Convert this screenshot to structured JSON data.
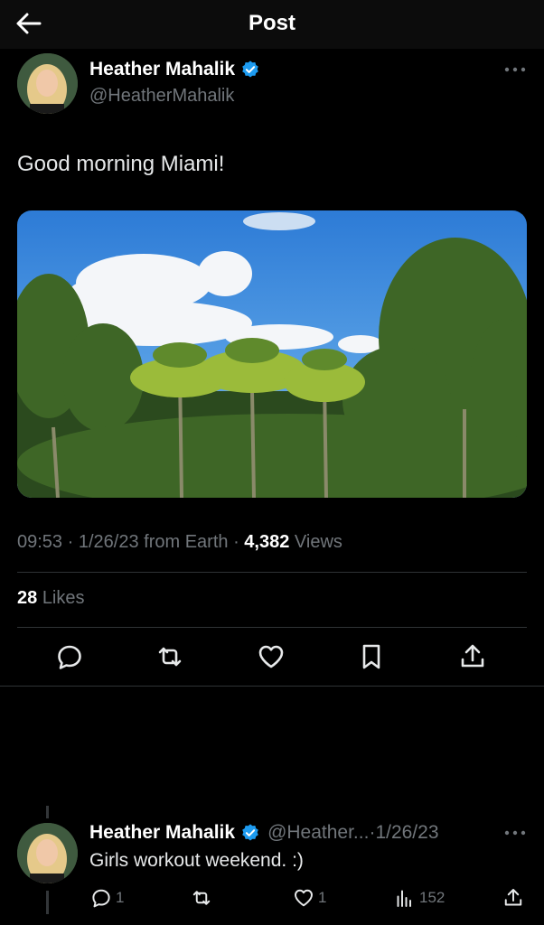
{
  "header": {
    "title": "Post"
  },
  "tweet": {
    "name": "Heather Mahalik",
    "handle": "@HeatherMahalik",
    "text": "Good morning Miami!",
    "time": "09:53",
    "date": "1/26/23",
    "source": "from Earth",
    "views_count": "4,382",
    "views_label": "Views",
    "likes_count": "28",
    "likes_label": "Likes"
  },
  "reply": {
    "name": "Heather Mahalik",
    "handle": "@Heather...",
    "date": "1/26/23",
    "text": "Girls workout weekend. :)",
    "reply_count": "1",
    "like_count": "1",
    "views_count": "152"
  },
  "icons": {
    "back": "arrow-left-icon",
    "verified": "verified-badge-icon",
    "more": "more-dots-icon",
    "reply": "reply-icon",
    "retweet": "retweet-icon",
    "like": "heart-icon",
    "bookmark": "bookmark-icon",
    "share": "share-icon",
    "views": "analytics-icon"
  },
  "colors": {
    "background": "#000000",
    "accent": "#1d9bf0",
    "muted": "#71767b",
    "text": "#e7e9ea"
  }
}
